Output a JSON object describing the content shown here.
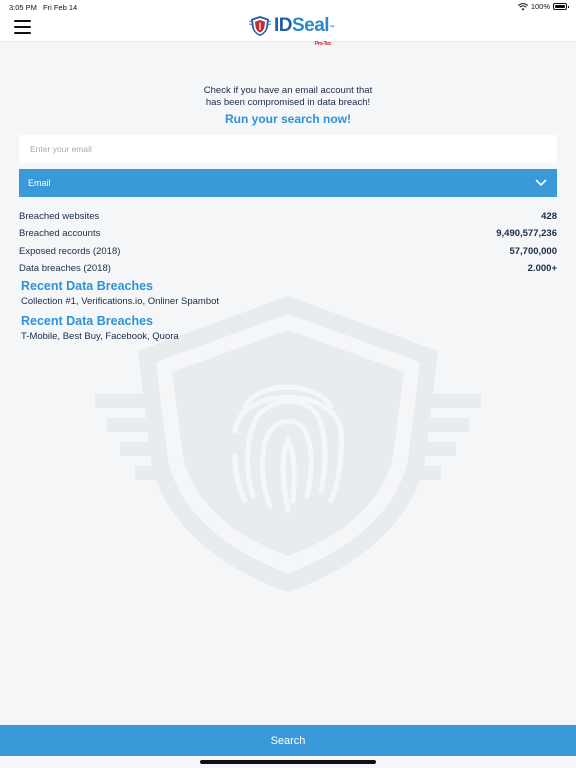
{
  "status_bar": {
    "time": "3:05 PM",
    "date": "Fri Feb 14",
    "battery": "100%",
    "battery_level": 1.0
  },
  "nav": {
    "logo_id": "ID",
    "logo_seal": "Seal",
    "logo_tm": "™",
    "logo_sub": "Pro-Tec"
  },
  "intro": {
    "line1": "Check if you have an email account that",
    "line2": "has been compromised in data breach!",
    "cta": "Run your search now!"
  },
  "search": {
    "placeholder": "Enter your email",
    "type_selected": "Email",
    "button_label": "Search"
  },
  "stats": [
    {
      "label": "Breached websites",
      "value": "428"
    },
    {
      "label": "Breached accounts",
      "value": "9,490,577,236"
    },
    {
      "label": "Exposed records (2018)",
      "value": "57,700,000"
    },
    {
      "label": "Data breaches (2018)",
      "value": "2.000+"
    }
  ],
  "recent": [
    {
      "title": "Recent Data Breaches",
      "items": "Collection #1, Verifications.io, Onliner Spambot"
    },
    {
      "title": "Recent Data Breaches",
      "items": "T-Mobile, Best Buy, Facebook, Quora"
    }
  ],
  "colors": {
    "accent": "#3a9ad9",
    "accent_text": "#2e93d6",
    "text": "#1c2b4a",
    "background": "#f4f6f8"
  }
}
